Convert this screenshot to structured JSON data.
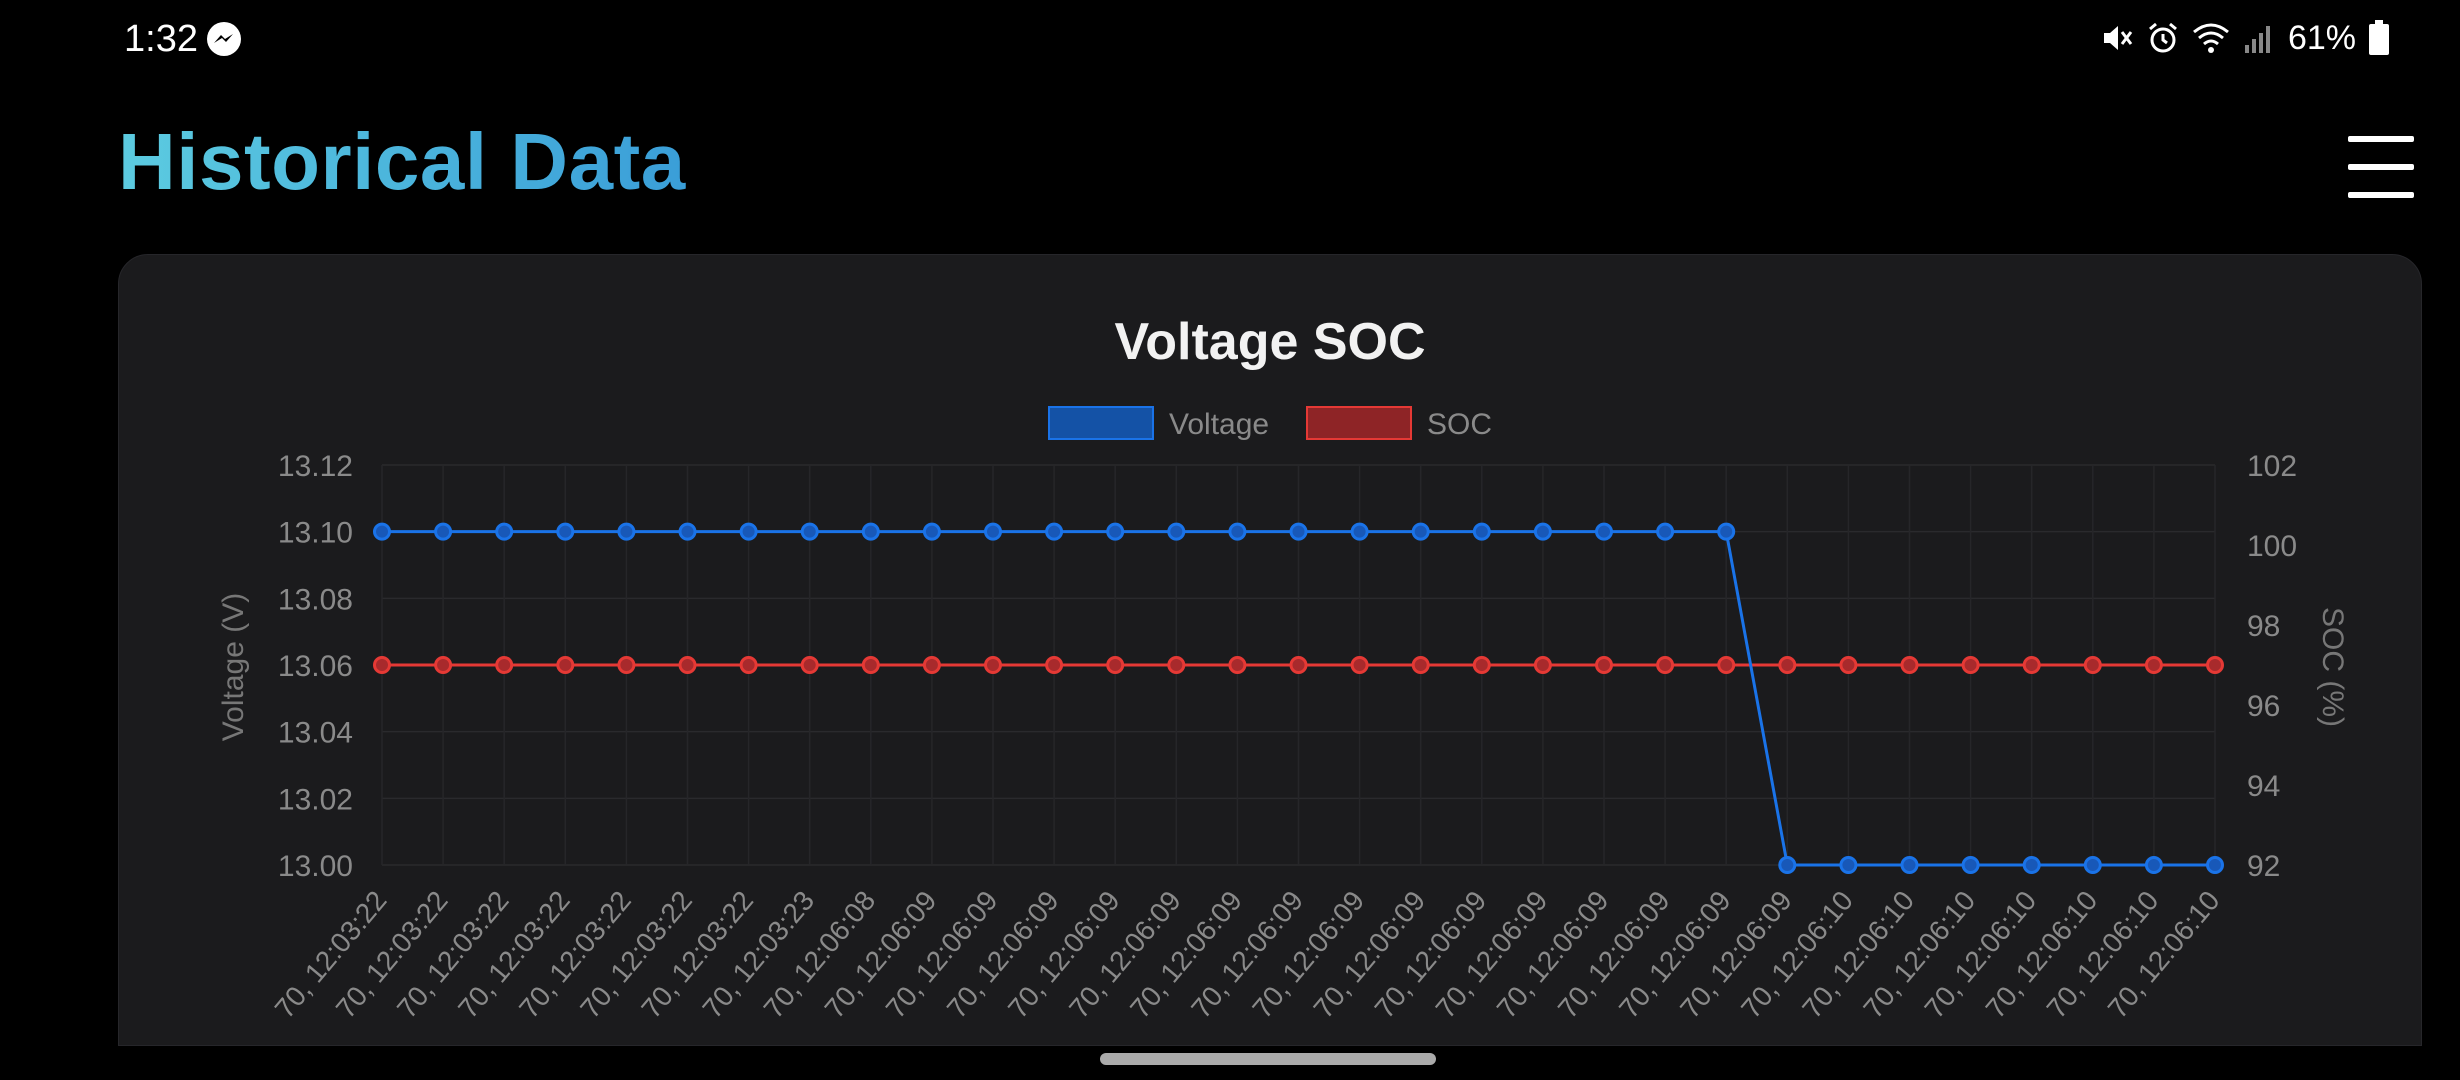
{
  "status_bar": {
    "time": "1:32",
    "battery": "61%",
    "icons": [
      "messenger-icon",
      "mute-icon",
      "alarm-icon",
      "wifi-icon",
      "signal-icon",
      "battery-icon"
    ]
  },
  "header": {
    "title": "Historical Data",
    "menu_icon": "hamburger-menu-icon"
  },
  "colors": {
    "voltage": "#1a73e8",
    "soc": "#e53935",
    "title_gradient_start": "#5ccbe0",
    "title_gradient_end": "#3a9ed8"
  },
  "chart_data": {
    "type": "line",
    "title": "Voltage SOC",
    "legend": [
      "Voltage",
      "SOC"
    ],
    "legend_position": "top-center",
    "grid": true,
    "y_left": {
      "label": "Voltage (V)",
      "range": [
        13.0,
        13.12
      ],
      "ticks": [
        "13.12",
        "13.10",
        "13.08",
        "13.06",
        "13.04",
        "13.02",
        "13.00"
      ]
    },
    "y_right": {
      "label": "SOC (%)",
      "range": [
        92,
        102
      ],
      "ticks": [
        "102",
        "100",
        "98",
        "96",
        "94",
        "92"
      ]
    },
    "x_labels": [
      "70, 12:03:22",
      "70, 12:03:22",
      "70, 12:03:22",
      "70, 12:03:22",
      "70, 12:03:22",
      "70, 12:03:22",
      "70, 12:03:22",
      "70, 12:03:23",
      "70, 12:06:08",
      "70, 12:06:09",
      "70, 12:06:09",
      "70, 12:06:09",
      "70, 12:06:09",
      "70, 12:06:09",
      "70, 12:06:09",
      "70, 12:06:09",
      "70, 12:06:09",
      "70, 12:06:09",
      "70, 12:06:09",
      "70, 12:06:09",
      "70, 12:06:09",
      "70, 12:06:09",
      "70, 12:06:09",
      "70, 12:06:09",
      "70, 12:06:10",
      "70, 12:06:10",
      "70, 12:06:10",
      "70, 12:06:10",
      "70, 12:06:10",
      "70, 12:06:10",
      "70, 12:06:10"
    ],
    "series": [
      {
        "name": "Voltage",
        "axis": "left",
        "values": [
          13.1,
          13.1,
          13.1,
          13.1,
          13.1,
          13.1,
          13.1,
          13.1,
          13.1,
          13.1,
          13.1,
          13.1,
          13.1,
          13.1,
          13.1,
          13.1,
          13.1,
          13.1,
          13.1,
          13.1,
          13.1,
          13.1,
          13.1,
          13.0,
          13.0,
          13.0,
          13.0,
          13.0,
          13.0,
          13.0,
          13.0
        ]
      },
      {
        "name": "SOC",
        "axis": "right",
        "values": [
          97,
          97,
          97,
          97,
          97,
          97,
          97,
          97,
          97,
          97,
          97,
          97,
          97,
          97,
          97,
          97,
          97,
          97,
          97,
          97,
          97,
          97,
          97,
          97,
          97,
          97,
          97,
          97,
          97,
          97,
          97
        ]
      }
    ]
  }
}
